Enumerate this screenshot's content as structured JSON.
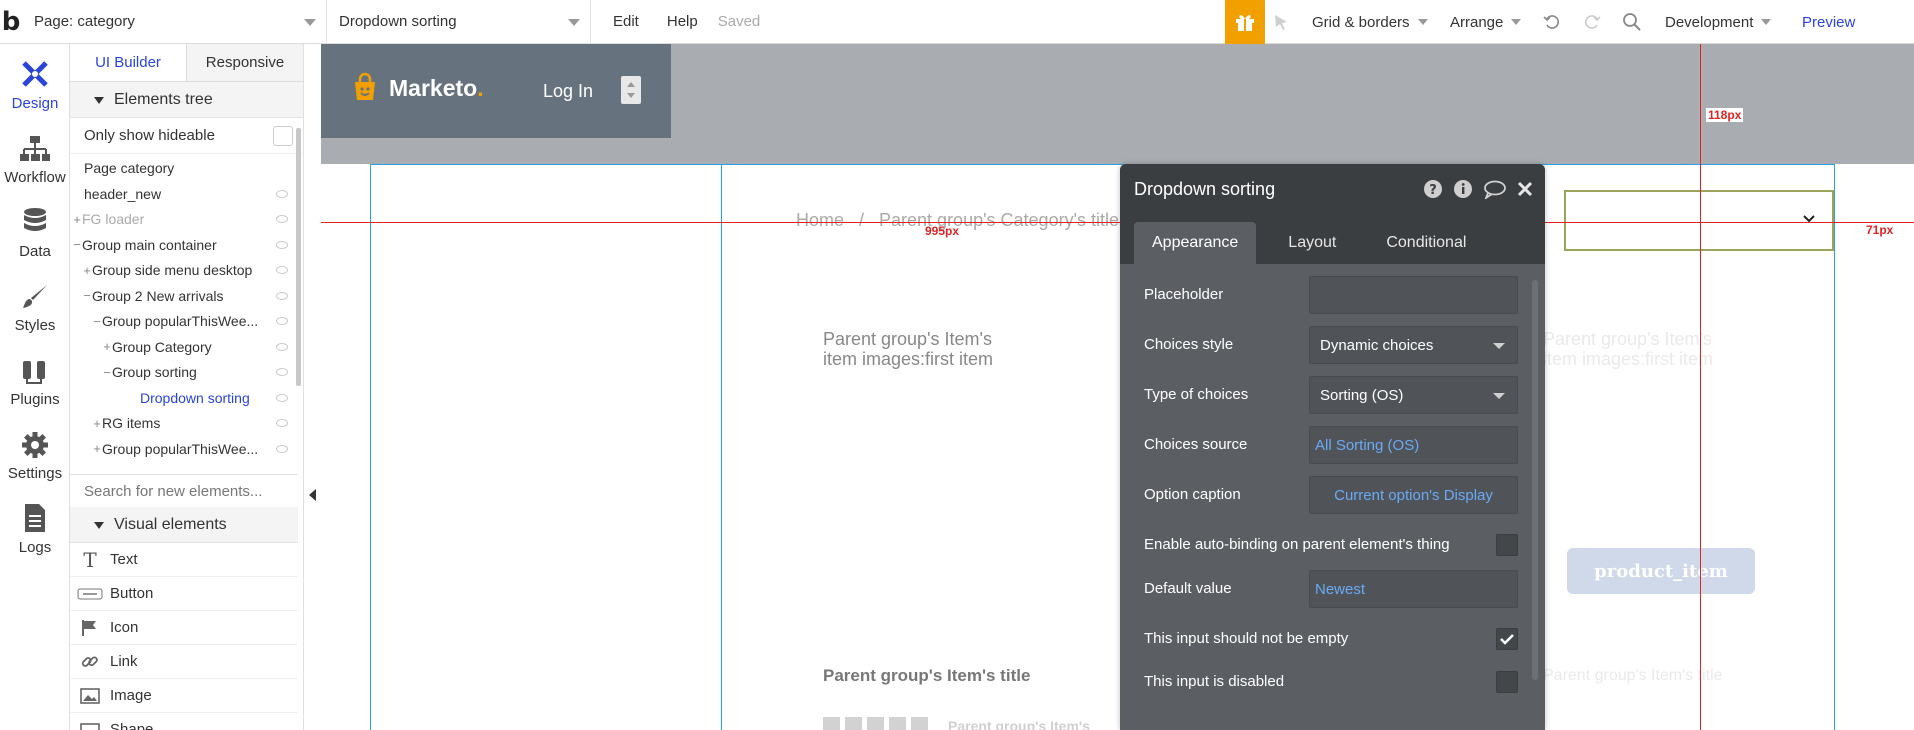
{
  "topbar": {
    "logo": "b",
    "page_select": "Page: category",
    "element_select": "Dropdown sorting",
    "edit": "Edit",
    "help": "Help",
    "saved": "Saved",
    "grid": "Grid & borders",
    "arrange": "Arrange",
    "development": "Development",
    "preview": "Preview"
  },
  "rail": [
    {
      "label": "Design",
      "icon": "design-icon",
      "active": true
    },
    {
      "label": "Workflow",
      "icon": "workflow-icon"
    },
    {
      "label": "Data",
      "icon": "database-icon"
    },
    {
      "label": "Styles",
      "icon": "brush-icon"
    },
    {
      "label": "Plugins",
      "icon": "plug-icon"
    },
    {
      "label": "Settings",
      "icon": "gear-icon"
    },
    {
      "label": "Logs",
      "icon": "document-icon"
    }
  ],
  "panel": {
    "tab_builder": "UI Builder",
    "tab_responsive": "Responsive",
    "elements_tree": "Elements tree",
    "only_hideable": "Only show hideable",
    "tree": [
      {
        "label": "Page category",
        "indent": 0,
        "pm": ""
      },
      {
        "label": "header_new",
        "indent": 0,
        "pm": ""
      },
      {
        "label": "FG loader",
        "indent": 0,
        "pm": "+",
        "dim": true
      },
      {
        "label": "Group main container",
        "indent": 0,
        "pm": "−"
      },
      {
        "label": "Group side menu desktop",
        "indent": 1,
        "pm": "+"
      },
      {
        "label": "Group 2 New arrivals",
        "indent": 1,
        "pm": "−"
      },
      {
        "label": "Group popularThisWee...",
        "indent": 2,
        "pm": "−"
      },
      {
        "label": "Group Category",
        "indent": 3,
        "pm": "+"
      },
      {
        "label": "Group sorting",
        "indent": 3,
        "pm": "−"
      },
      {
        "label": "Dropdown sorting",
        "indent": 4,
        "pm": "",
        "selected": true
      },
      {
        "label": "RG items",
        "indent": 2,
        "pm": "+"
      },
      {
        "label": "Group popularThisWee...",
        "indent": 2,
        "pm": "+"
      }
    ],
    "search_placeholder": "Search for new elements...",
    "visual_elements": "Visual elements",
    "visual": [
      {
        "label": "Text",
        "icon": "text-icon"
      },
      {
        "label": "Button",
        "icon": "button-icon"
      },
      {
        "label": "Icon",
        "icon": "flag-icon"
      },
      {
        "label": "Link",
        "icon": "link-icon"
      },
      {
        "label": "Image",
        "icon": "image-icon"
      },
      {
        "label": "Shape",
        "icon": "shape-icon"
      }
    ]
  },
  "canvas": {
    "brand": "Marketo",
    "brand_dot": ".",
    "login": "Log In",
    "breadcrumb": "Home   /   Parent group's Category's title",
    "item_image_line1": "Parent group's Item's",
    "item_image_line2": "item  images:first item",
    "item_title": "Parent group's Item's title",
    "price_ghost": "Parent group's Item's",
    "product_button": "product_item",
    "measure_995": "995px",
    "measure_118": "118px",
    "measure_71": "71px"
  },
  "editor": {
    "title": "Dropdown sorting",
    "tabs": [
      "Appearance",
      "Layout",
      "Conditional"
    ],
    "placeholder_label": "Placeholder",
    "placeholder_value": "",
    "choices_style_label": "Choices style",
    "choices_style_value": "Dynamic choices",
    "type_label": "Type of choices",
    "type_value": "Sorting (OS)",
    "source_label": "Choices source",
    "source_value": "All Sorting (OS)",
    "caption_label": "Option caption",
    "caption_value": "Current option's Display",
    "autobind_label": "Enable auto-binding on parent element's thing",
    "default_label": "Default value",
    "default_value": "Newest",
    "not_empty_label": "This input should not be empty",
    "not_empty_checked": true,
    "disabled_label": "This input is disabled",
    "disabled_checked": false
  },
  "colors": {
    "accent": "#2b44d8",
    "gift": "#f2a000",
    "editor_bg": "#5b5f63",
    "editor_head": "#3b3e41",
    "link": "#6aaaf5",
    "measure": "#e02424",
    "frame": "#2aa0e8"
  }
}
